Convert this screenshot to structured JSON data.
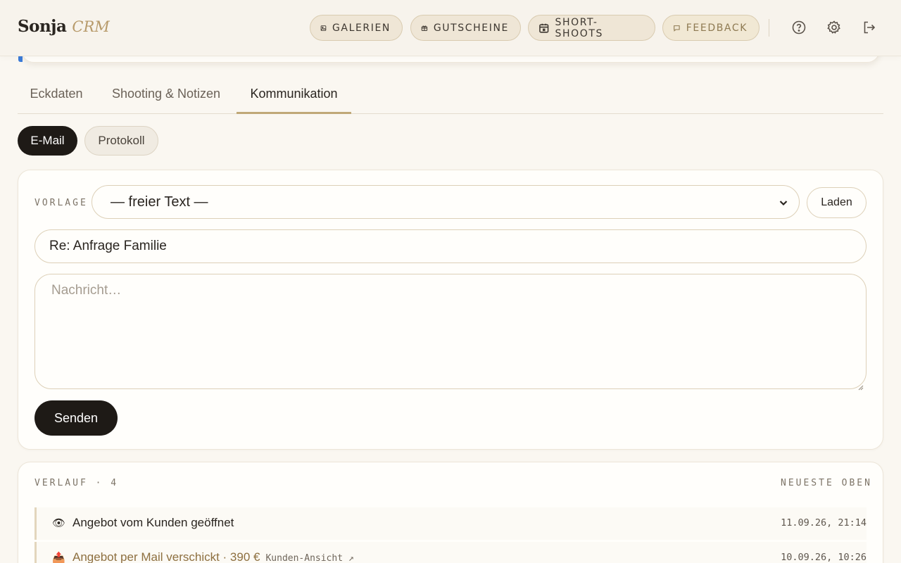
{
  "brand": {
    "name": "Sonja",
    "suffix": "CRM"
  },
  "nav": {
    "galerien": "GALERIEN",
    "gutscheine": "GUTSCHEINE",
    "short_shoots": "SHORT-SHOOTS",
    "feedback": "FEEDBACK"
  },
  "top_icons": [
    "help-icon",
    "gear-icon",
    "logout-icon"
  ],
  "tabs": [
    "Eckdaten",
    "Shooting & Notizen",
    "Kommunikation"
  ],
  "active_tab": "Kommunikation",
  "subtabs": {
    "email": "E-Mail",
    "protokoll": "Protokoll"
  },
  "compose": {
    "vorlage_label": "VORLAGE",
    "vorlage_value": "— freier Text —",
    "laden_label": "Laden",
    "subject_value": "Re: Anfrage Familie",
    "message_placeholder": "Nachricht…",
    "send_label": "Senden"
  },
  "history": {
    "title": "VERLAUF · 4",
    "sort_label": "NEUESTE OBEN",
    "items": [
      {
        "icon": "👁",
        "text": "Angebot vom Kunden geöffnet",
        "time": "11.09.26, 21:14"
      },
      {
        "icon": "📤",
        "text": "Angebot per Mail verschickt · 390 €",
        "link": "Kunden-Ansicht ↗",
        "time": "10.09.26, 10:26"
      }
    ]
  },
  "colors": {
    "accent_gold": "#c0a878",
    "dark": "#1e1a16",
    "background": "#faf7f1"
  }
}
